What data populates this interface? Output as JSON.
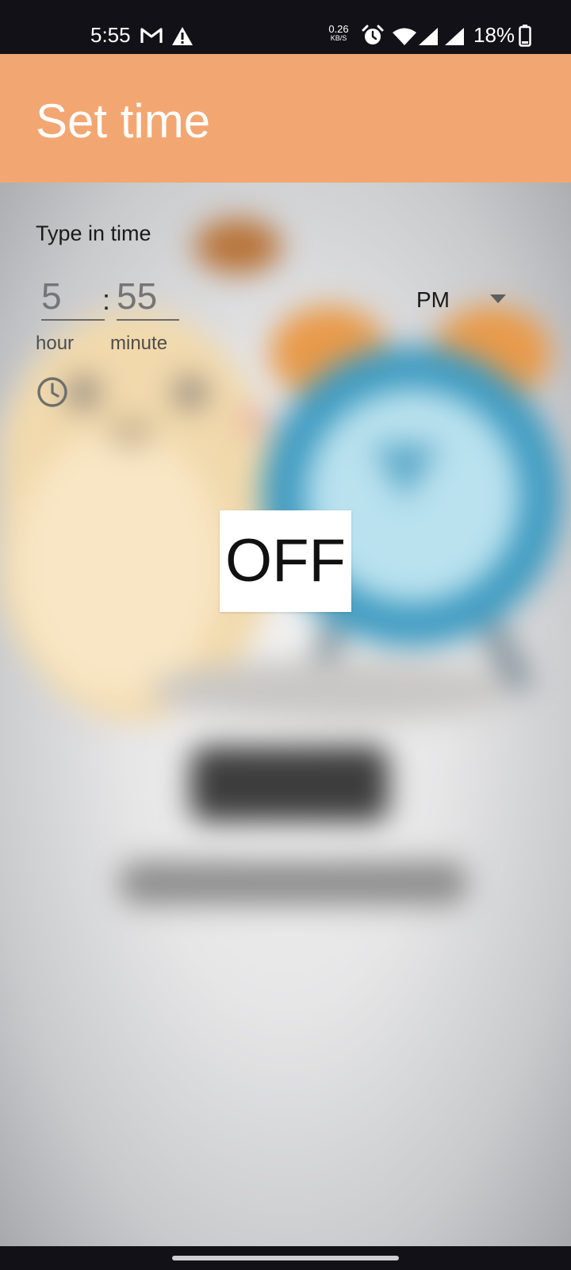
{
  "status_bar": {
    "time": "5:55",
    "network_speed_value": "0.26",
    "network_speed_unit": "KB/S",
    "battery_percent": "18%",
    "icons": [
      "gmail-icon",
      "warning-icon",
      "alarm-icon",
      "wifi-icon",
      "signal-icon",
      "signal-icon",
      "battery-icon"
    ]
  },
  "app_bar": {
    "title": "Set time",
    "background_color": "#f2a773"
  },
  "form": {
    "type_in_label": "Type in time",
    "hour": {
      "value": "",
      "placeholder": "5",
      "label": "hour"
    },
    "colon": ":",
    "minute": {
      "value": "",
      "placeholder": "55",
      "label": "minute"
    },
    "ampm": {
      "selected": "PM"
    },
    "clock_toggle_icon": "clock-icon"
  },
  "toggle_button": {
    "label": "OFF"
  },
  "nav_bar": {
    "handle": "gesture-handle"
  }
}
